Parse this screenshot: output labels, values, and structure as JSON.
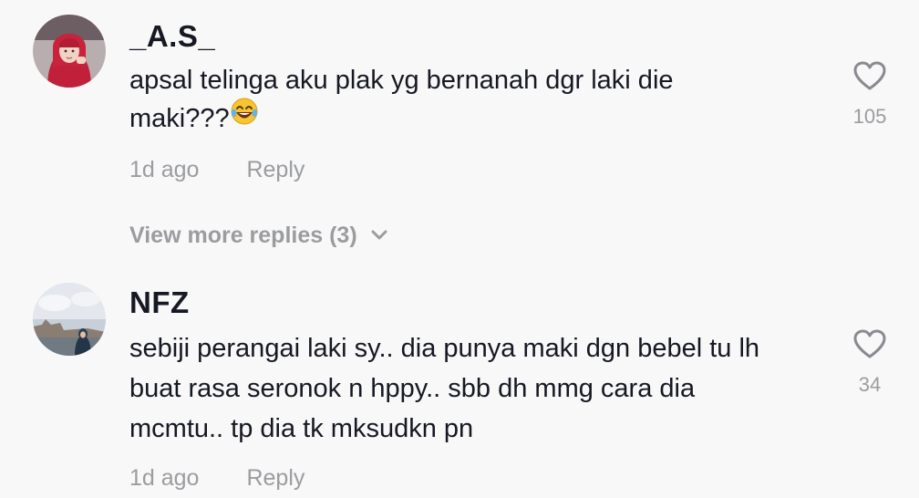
{
  "comments": [
    {
      "username": "_A.S_",
      "text_lines": [
        "apsal telinga aku plak yg bernanah dgr laki die",
        "maki???"
      ],
      "emoji": "face-with-tears-of-joy",
      "time": "1d ago",
      "reply_label": "Reply",
      "like_count": "105",
      "like_icon": "heart-outline-icon"
    },
    {
      "username": "NFZ",
      "text_lines": [
        "sebiji perangai laki sy.. dia punya maki dgn bebel tu lh",
        "buat rasa seronok n hppy.. sbb dh mmg cara dia",
        "mcmtu.. tp dia tk mksudkn pn"
      ],
      "time": "1d ago",
      "reply_label": "Reply",
      "like_count": "34",
      "like_icon": "heart-outline-icon"
    }
  ],
  "view_more_replies": {
    "label": "View more replies (3)",
    "icon": "chevron-down-icon"
  },
  "colors": {
    "background": "#f8f8f8",
    "primary_text": "#161823",
    "secondary_text": "#9b9ca0",
    "heart_outline": "#8a8b91"
  }
}
